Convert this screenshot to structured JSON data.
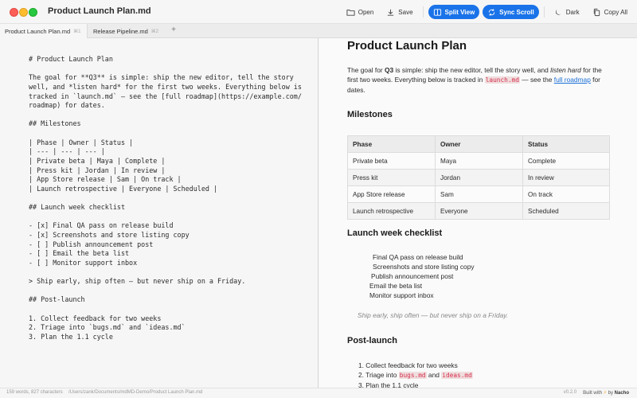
{
  "window": {
    "title": "Product Launch Plan.md"
  },
  "toolbar": {
    "open": "Open",
    "save": "Save",
    "split_view": "Split View",
    "sync_scroll": "Sync Scroll",
    "dark": "Dark",
    "copy_all": "Copy All"
  },
  "tabs": [
    {
      "label": "Product Launch Plan.md",
      "shortcut": "⌘1"
    },
    {
      "label": "Release Pipeline.md",
      "shortcut": "⌘2"
    }
  ],
  "add_tab": "+",
  "editor": {
    "source": "# Product Launch Plan\n\nThe goal for **Q3** is simple: ship the new editor, tell the story\nwell, and *listen hard* for the first two weeks. Everything below is\ntracked in `launch.md` — see the [full roadmap](https://example.com/\nroadmap) for dates.\n\n## Milestones\n\n| Phase | Owner | Status |\n| --- | --- | --- |\n| Private beta | Maya | Complete |\n| Press kit | Jordan | In review |\n| App Store release | Sam | On track |\n| Launch retrospective | Everyone | Scheduled |\n\n## Launch week checklist\n\n- [x] Final QA pass on release build\n- [x] Screenshots and store listing copy\n- [ ] Publish announcement post\n- [ ] Email the beta list\n- [ ] Monitor support inbox\n\n> Ship early, ship often — but never ship on a Friday.\n\n## Post-launch\n\n1. Collect feedback for two weeks\n2. Triage into `bugs.md` and `ideas.md`\n3. Plan the 1.1 cycle"
  },
  "preview": {
    "h1": "Product Launch Plan",
    "intro": {
      "p1": "The goal for ",
      "bold": "Q3",
      "p2": " is simple: ship the new editor, tell the story well, and ",
      "italic": "listen hard",
      "p3": " for the first two weeks. Everything below is tracked in ",
      "code": "launch.md",
      "p4": " — see the ",
      "link": "full roadmap",
      "p5": " for dates."
    },
    "milestones_heading": "Milestones",
    "table": {
      "headers": [
        "Phase",
        "Owner",
        "Status"
      ],
      "rows": [
        [
          "Private beta",
          "Maya",
          "Complete"
        ],
        [
          "Press kit",
          "Jordan",
          "In review"
        ],
        [
          "App Store release",
          "Sam",
          "On track"
        ],
        [
          "Launch retrospective",
          "Everyone",
          "Scheduled"
        ]
      ]
    },
    "checklist_heading": "Launch week checklist",
    "checklist": [
      {
        "text": "Final QA pass on release build",
        "checked": true
      },
      {
        "text": "Screenshots and store listing copy",
        "checked": true
      },
      {
        "text": "Publish announcement post",
        "checked": false
      },
      {
        "text": "Email the beta list",
        "checked": false
      },
      {
        "text": "Monitor support inbox",
        "checked": false
      }
    ],
    "quote": "Ship early, ship often — but never ship on a Friday.",
    "postlaunch_heading": "Post-launch",
    "postlaunch": {
      "item1": "1. Collect feedback for two weeks",
      "item2_prefix": "2. Triage into ",
      "item2_code1": "bugs.md",
      "item2_mid": " and ",
      "item2_code2": "ideas.md",
      "item3": "3. Plan the 1.1 cycle"
    }
  },
  "statusbar": {
    "counts": "159 words, 827 characters",
    "path": "/Users/zank/Documents/mdMD-Demo/Product Launch Plan.md",
    "version": "v0.2.0",
    "built_prefix": "Built with",
    "built_by": "by",
    "author": "Nacho"
  },
  "colors": {
    "accent": "#1a73e8",
    "code": "#d6304e",
    "link": "#1a6fd6"
  }
}
